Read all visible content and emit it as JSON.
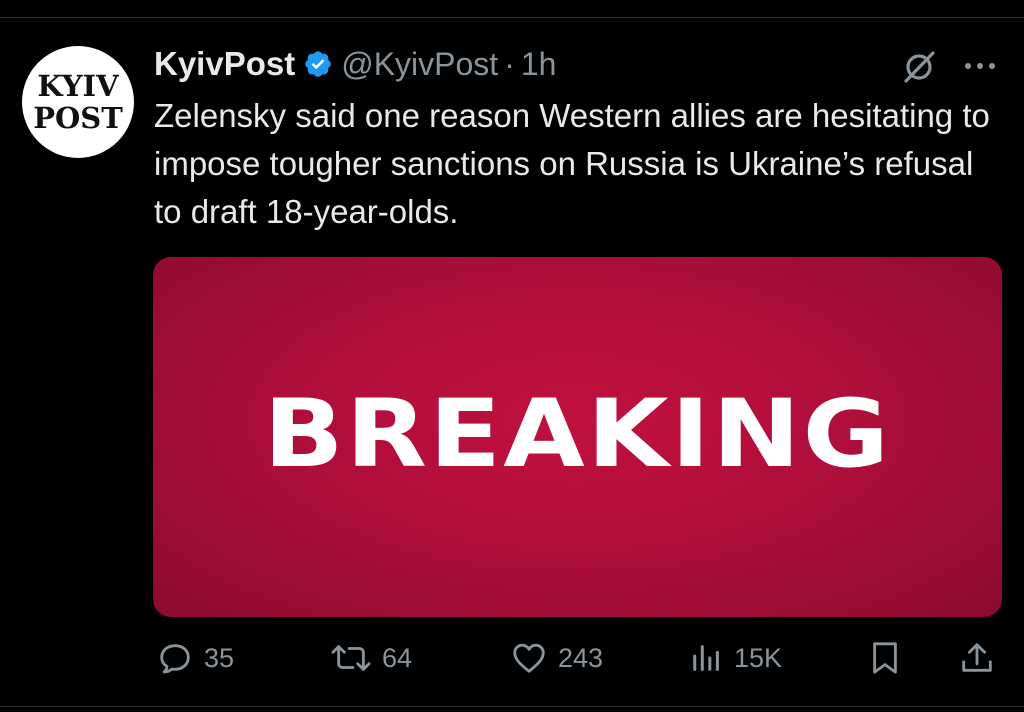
{
  "tweet": {
    "author": {
      "avatar_line1": "KYIV",
      "avatar_line2": "POST",
      "name": "KyivPost",
      "handle": "@KyivPost",
      "separator": "·",
      "time": "1h",
      "verified": true
    },
    "text": "Zelensky said one reason Western allies are hesitating to impose tougher sanctions on Russia is Ukraine’s refusal to draft 18-year-olds.",
    "media": {
      "headline": "BREAKING",
      "background_color": "#b00e3b"
    },
    "stats": {
      "replies": "35",
      "reposts": "64",
      "likes": "243",
      "views": "15K"
    }
  },
  "icons": {
    "verified": "verified-badge-icon",
    "grok": "grok-icon",
    "more": "more-icon",
    "reply": "reply-icon",
    "repost": "repost-icon",
    "like": "like-icon",
    "views": "views-icon",
    "bookmark": "bookmark-icon",
    "share": "share-icon"
  },
  "colors": {
    "background": "#000000",
    "text": "#e7e9ea",
    "muted": "#8b949a",
    "verified": "#1d9bf0",
    "media_red": "#b00e3b"
  }
}
